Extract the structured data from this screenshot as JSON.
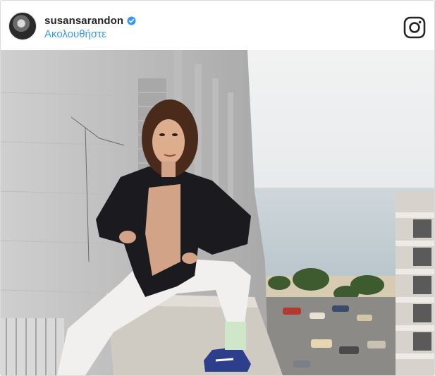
{
  "post": {
    "username": "susansarandon",
    "follow_label": "Ακολουθήστε",
    "verified_icon": "verified-badge-icon",
    "platform_icon": "instagram-icon"
  },
  "colors": {
    "username": "#262626",
    "follow_link": "#3897f0",
    "verified": "#3897f0",
    "border": "#dbdbdb"
  }
}
